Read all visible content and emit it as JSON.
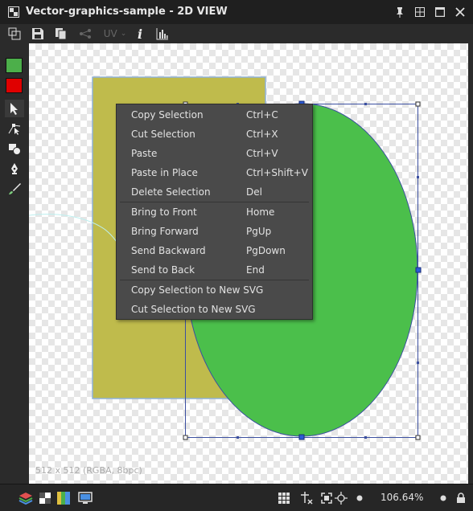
{
  "window": {
    "title": "Vector-graphics-sample - 2D VIEW",
    "controls": [
      "pin-icon",
      "tile-icon",
      "maximize-icon",
      "close-icon"
    ]
  },
  "toolbar": {
    "uv_label": "UV",
    "info_label": "i",
    "icons": [
      "view-mode-icon",
      "save-icon",
      "copy-icon",
      "share-icon",
      "uv-icon",
      "info-icon",
      "histogram-icon"
    ]
  },
  "left_tools": {
    "primary_color": "#4caf4a",
    "secondary_color": "#e00000",
    "icons": [
      "select-arrow-icon",
      "node-edit-icon",
      "shape-tool-icon",
      "pen-tool-icon",
      "brush-tool-icon"
    ]
  },
  "canvas": {
    "image_info": "512 x 512 (RGBA, 8bpc)",
    "rect_color": "#bfbb4c",
    "ellipse_color": "#4bbf4b"
  },
  "context_menu": {
    "groups": [
      [
        {
          "label": "Copy Selection",
          "shortcut": "Ctrl+C"
        },
        {
          "label": "Cut Selection",
          "shortcut": "Ctrl+X"
        },
        {
          "label": "Paste",
          "shortcut": "Ctrl+V"
        },
        {
          "label": "Paste in Place",
          "shortcut": "Ctrl+Shift+V"
        },
        {
          "label": "Delete Selection",
          "shortcut": "Del"
        }
      ],
      [
        {
          "label": "Bring to Front",
          "shortcut": "Home"
        },
        {
          "label": "Bring Forward",
          "shortcut": "PgUp"
        },
        {
          "label": "Send Backward",
          "shortcut": "PgDown"
        },
        {
          "label": "Send to Back",
          "shortcut": "End"
        }
      ],
      [
        {
          "label": "Copy Selection to New SVG",
          "shortcut": ""
        },
        {
          "label": "Cut Selection to New SVG",
          "shortcut": ""
        }
      ]
    ]
  },
  "statusbar": {
    "zoom": "106.64%",
    "icons": [
      "layers-icon",
      "checker-icon",
      "channels-icon",
      "display-icon",
      "grid-icon",
      "snap-icon",
      "fit-icon",
      "center-icon",
      "zoom-out-icon",
      "zoom-in-icon",
      "lock-icon"
    ]
  }
}
